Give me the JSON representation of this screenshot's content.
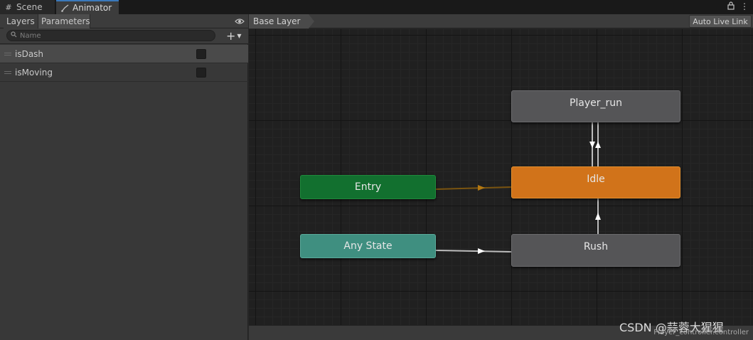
{
  "tabs": {
    "scene": "Scene",
    "animator": "Animator"
  },
  "left_panel": {
    "tab_layers": "Layers",
    "tab_parameters": "Parameters",
    "search_placeholder": "Name",
    "add_label": "+",
    "parameters": [
      {
        "name": "isDash",
        "type": "bool",
        "checked": false
      },
      {
        "name": "isMoving",
        "type": "bool",
        "checked": false
      }
    ]
  },
  "graph": {
    "breadcrumb": "Base Layer",
    "auto_live_link": "Auto Live Link",
    "states": {
      "player_run": "Player_run",
      "idle": "Idle",
      "entry": "Entry",
      "any_state": "Any State",
      "rush": "Rush"
    },
    "footer_path": "Player_controller.controller"
  },
  "colors": {
    "entry": "#12702f",
    "any_state": "#3f8f80",
    "default_state": "#d1731a",
    "state": "#555557",
    "tab_accent": "#3a79bb"
  },
  "watermark": "CSDN @蒜蓉大猩猩"
}
